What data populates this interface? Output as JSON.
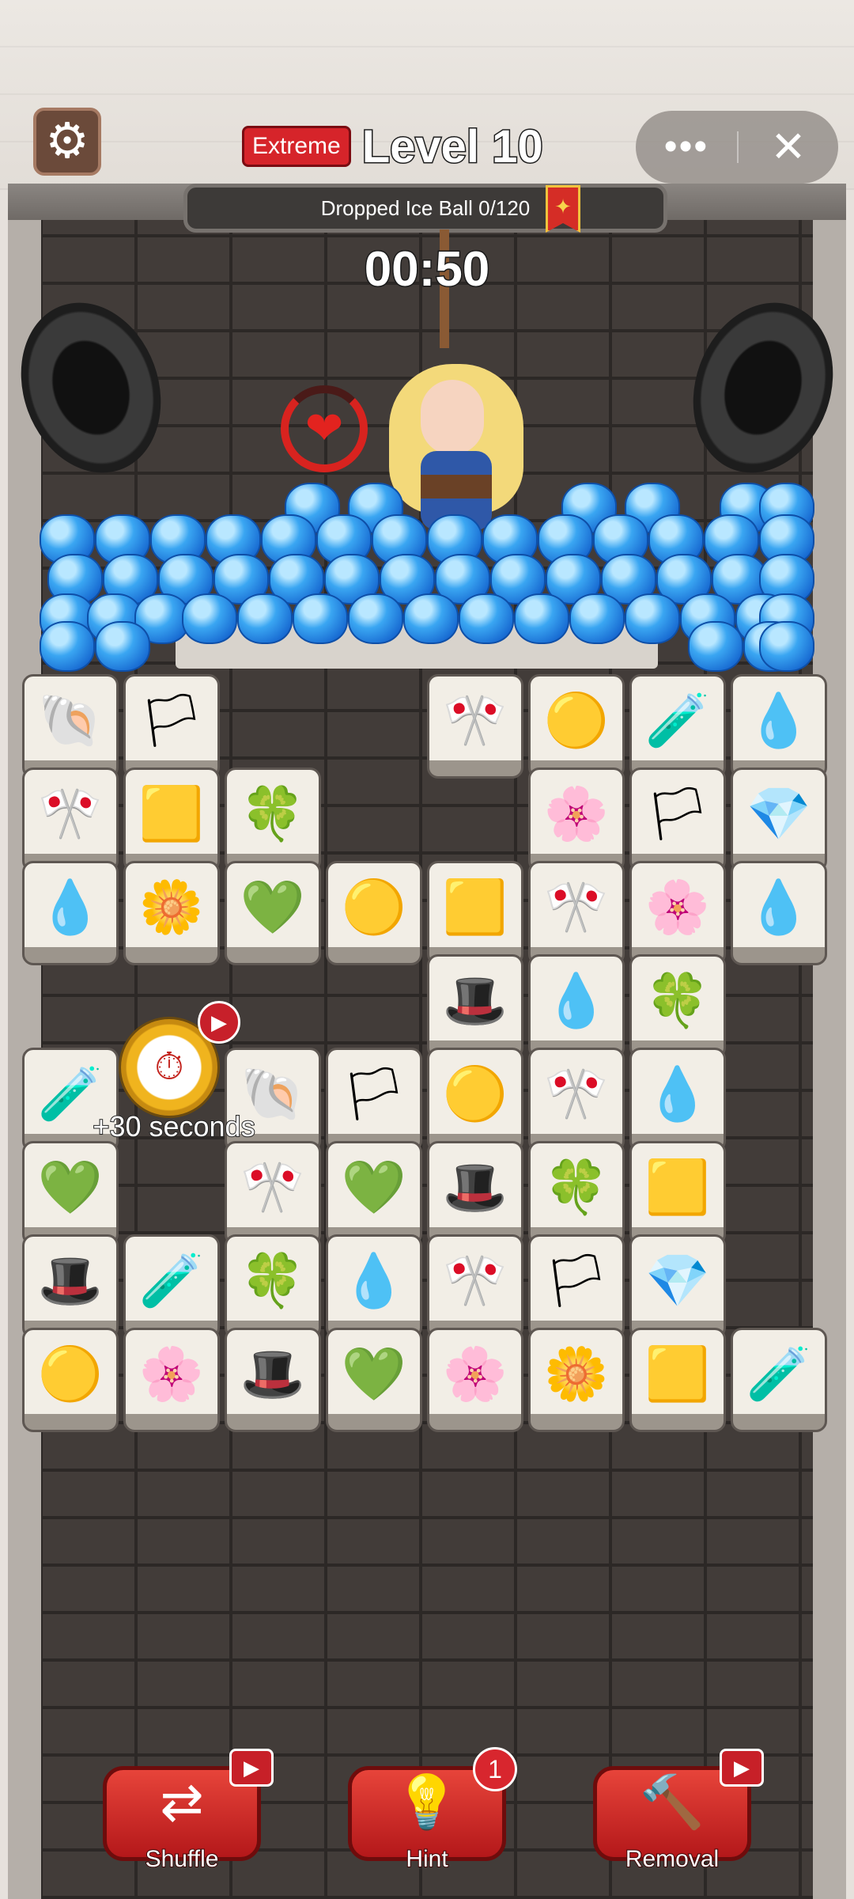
{
  "header": {
    "difficulty": "Extreme",
    "level_title": "Level 10",
    "menu_dots": "•••",
    "close": "✕",
    "settings_icon": "⚙"
  },
  "task": {
    "label": "Dropped Ice Ball  0/120",
    "ribbon_icon": "✦"
  },
  "timer": "00:50",
  "heart_icon": "❤",
  "bonus": {
    "label": "+30 seconds",
    "clock_icon": "⏱",
    "video_icon": "▶"
  },
  "tiles": [
    {
      "icon": "🐚"
    },
    {
      "icon": "🏳"
    },
    {
      "icon": "🎌"
    },
    {
      "icon": "🟡"
    },
    {
      "icon": "🧪"
    },
    {
      "icon": "💧"
    },
    {
      "icon": "🎌"
    },
    {
      "icon": "🟨"
    },
    {
      "icon": "🍀"
    },
    {
      "icon": "🌸"
    },
    {
      "icon": "🏳"
    },
    {
      "icon": "💎"
    },
    {
      "icon": "💧"
    },
    {
      "icon": "🌼"
    },
    {
      "icon": "💚"
    },
    {
      "icon": "🟡"
    },
    {
      "icon": "🟨"
    },
    {
      "icon": "🎌"
    },
    {
      "icon": "🌸"
    },
    {
      "icon": "💧"
    },
    {
      "icon": "🎩"
    },
    {
      "icon": "💧"
    },
    {
      "icon": "🍀"
    },
    {
      "icon": "🧪"
    },
    {
      "icon": "🐚"
    },
    {
      "icon": "🏳"
    },
    {
      "icon": "🟡"
    },
    {
      "icon": "🎌"
    },
    {
      "icon": "💧"
    },
    {
      "icon": "💚"
    },
    {
      "icon": "🎌"
    },
    {
      "icon": "💚"
    },
    {
      "icon": "🎩"
    },
    {
      "icon": "🍀"
    },
    {
      "icon": "🟨"
    },
    {
      "icon": "🎩"
    },
    {
      "icon": "🧪"
    },
    {
      "icon": "🍀"
    },
    {
      "icon": "💧"
    },
    {
      "icon": "🎌"
    },
    {
      "icon": "🏳"
    },
    {
      "icon": "💎"
    },
    {
      "icon": "🟡"
    },
    {
      "icon": "🌸"
    },
    {
      "icon": "🎩"
    },
    {
      "icon": "💚"
    },
    {
      "icon": "🌸"
    },
    {
      "icon": "🌼"
    },
    {
      "icon": "🟨"
    },
    {
      "icon": "🧪"
    }
  ],
  "tools": {
    "shuffle": {
      "label": "Shuffle",
      "icon": "⇄",
      "ad_icon": "▶"
    },
    "hint": {
      "label": "Hint",
      "icon": "💡",
      "count": "1"
    },
    "removal": {
      "label": "Removal",
      "icon": "🔨",
      "ad_icon": "▶"
    }
  }
}
